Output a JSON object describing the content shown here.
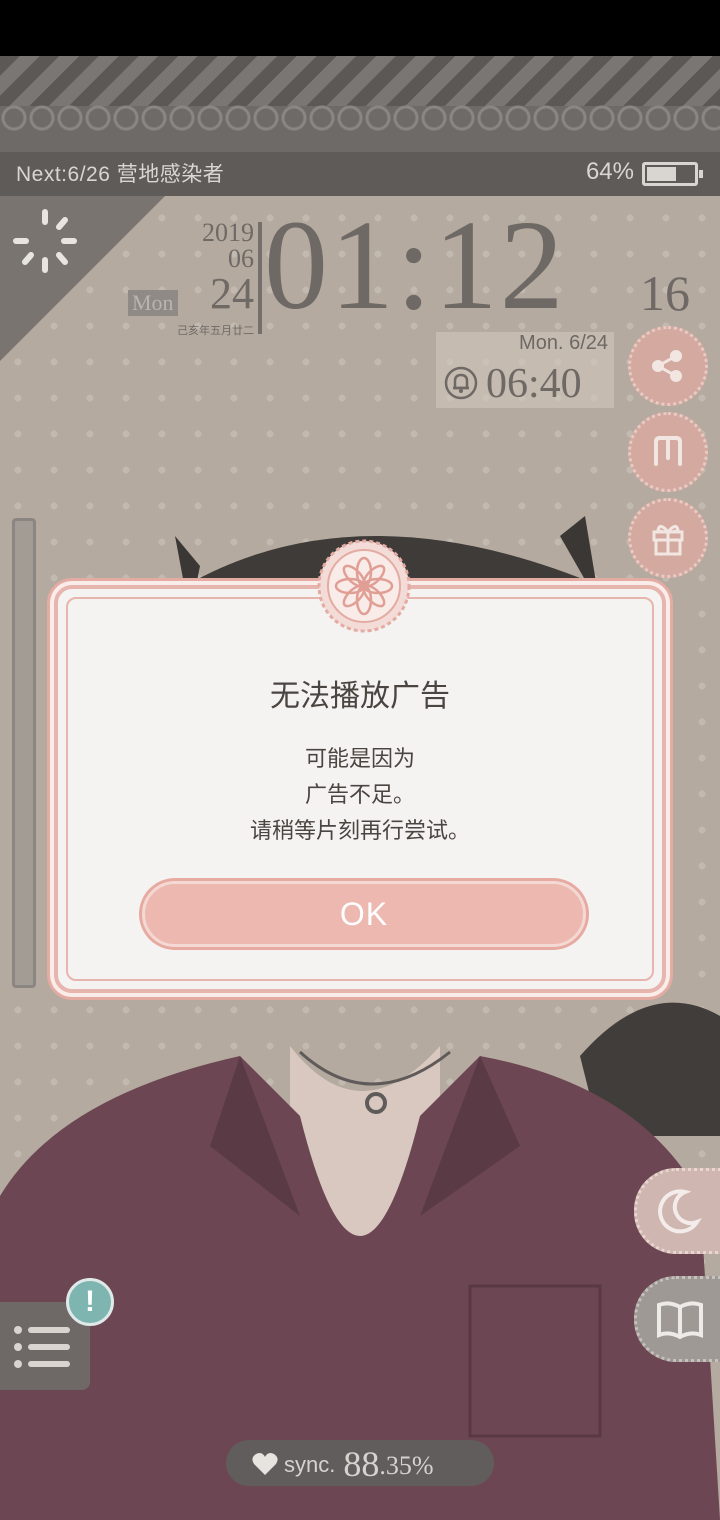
{
  "status": {
    "next_event": "Next:6/26 营地感染者",
    "battery_percent_text": "64%",
    "battery_level": 0.64
  },
  "clock": {
    "year": "2019",
    "month": "06",
    "day": "24",
    "weekday": "Mon",
    "lunar_date": "己亥年五月廿二",
    "time": "01:12",
    "seconds": "16",
    "date_small": "Mon.  6/24",
    "alarm_time": "06:40"
  },
  "side_buttons": {
    "right": [
      "share-icon",
      "m-icon",
      "gift-icon",
      "moon-icon",
      "book-icon"
    ],
    "left": [
      "menu-icon"
    ]
  },
  "dialog": {
    "title": "无法播放广告",
    "message_lines": [
      "可能是因为",
      "广告不足。",
      "请稍等片刻再行尝试。"
    ],
    "ok_label": "OK"
  },
  "sync": {
    "label": "sync.",
    "value_int": "88",
    "value_dec": ".35%"
  },
  "colors": {
    "accent_pink": "#ecb8b0",
    "dialog_bg": "#f5f3f1",
    "badge_teal": "#7fb5b1"
  }
}
